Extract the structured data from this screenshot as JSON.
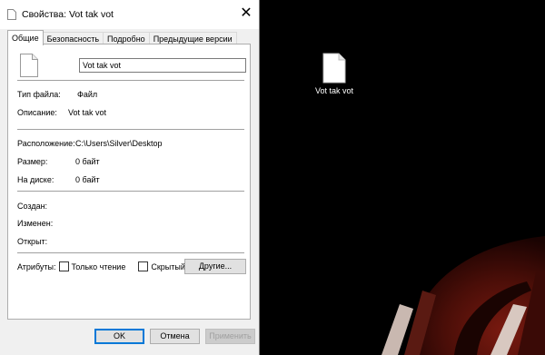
{
  "window": {
    "title": "Свойства: Vot tak vot"
  },
  "tabs": [
    {
      "label": "Общие",
      "active": true
    },
    {
      "label": "Безопасность"
    },
    {
      "label": "Подробно"
    },
    {
      "label": "Предыдущие версии"
    }
  ],
  "general": {
    "filename": "Vot tak vot",
    "file_type_label": "Тип файла:",
    "file_type_value": "Файл",
    "description_label": "Описание:",
    "description_value": "Vot tak vot",
    "location_label": "Расположение:",
    "location_value": "C:\\Users\\Silver\\Desktop",
    "size_label": "Размер:",
    "size_value": "0 байт",
    "on_disk_label": "На диске:",
    "on_disk_value": "0 байт",
    "created_label": "Создан:",
    "modified_label": "Изменен:",
    "opened_label": "Открыт:",
    "attributes_label": "Атрибуты:",
    "readonly_label": "Только чтение",
    "hidden_label": "Скрытый",
    "other_button": "Другие..."
  },
  "buttons": {
    "ok": "OK",
    "cancel": "Отмена",
    "apply": "Применить"
  },
  "desktop": {
    "file_label": "Vot tak vot"
  },
  "colors": {
    "accent": "#0078d7",
    "dialog_bg": "#f0f0f0",
    "desktop_bg": "#000000"
  }
}
